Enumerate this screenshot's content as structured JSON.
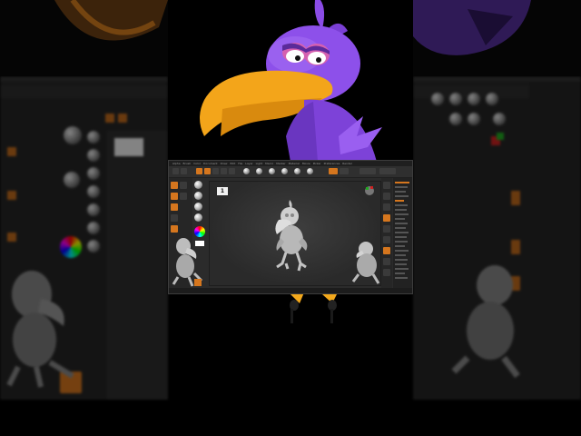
{
  "app": {
    "name": "ZBrush",
    "menu": [
      "Alpha",
      "Brush",
      "Color",
      "Document",
      "Draw",
      "Edit",
      "File",
      "Layer",
      "Light",
      "Macro",
      "Marker",
      "Material",
      "Movie",
      "Picker",
      "Preferences",
      "Render",
      "Stencil",
      "Stroke",
      "Texture",
      "Tool",
      "Transform",
      "Zplugin",
      "Zscript",
      "Help"
    ],
    "document_number": "1",
    "accent_color": "#d5761e"
  },
  "toolbar": {
    "buttons": [
      "projection",
      "lightbox",
      "live-boolean",
      "edit",
      "draw",
      "move",
      "scale",
      "rotate"
    ],
    "material_spheres": 6
  },
  "status": {
    "text": ""
  },
  "scene": {
    "subject": "crow character sculpt",
    "cartoon_colors": {
      "body": "#8a4de8",
      "beak": "#f2a81c",
      "eye_lid": "#d15aa0"
    }
  }
}
